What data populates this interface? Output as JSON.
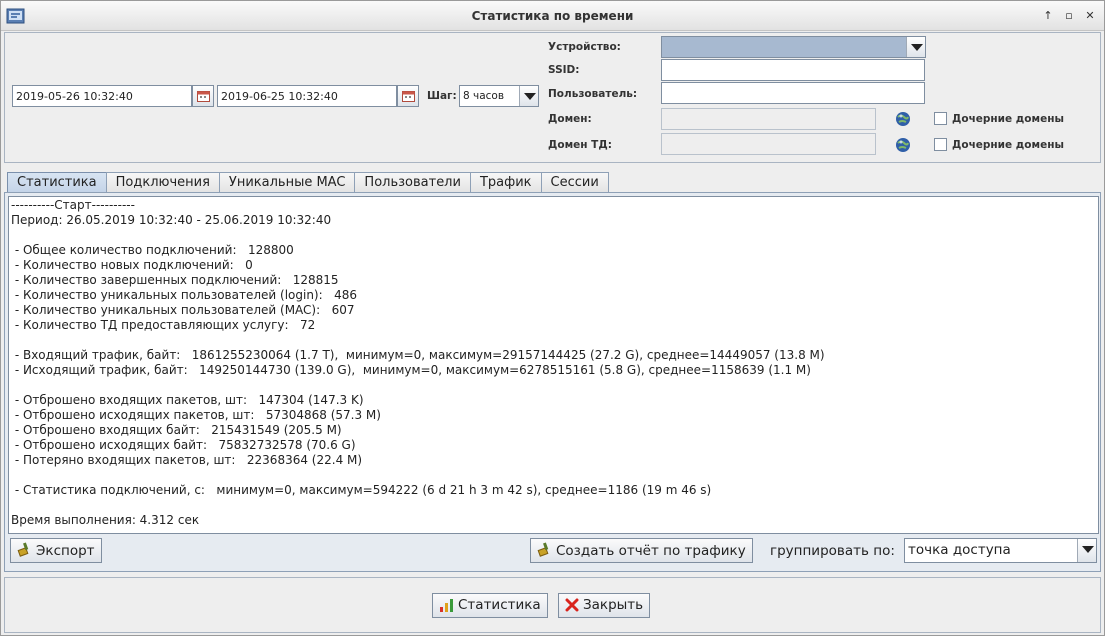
{
  "window": {
    "title": "Статистика по времени"
  },
  "filters": {
    "date_from": "2019-05-26 10:32:40",
    "date_to": "2019-06-25 10:32:40",
    "step_label": "Шаг:",
    "step_value": "8 часов",
    "device_label": "Устройство:",
    "device_value": "",
    "ssid_label": "SSID:",
    "ssid_value": "",
    "user_label": "Пользователь:",
    "user_value": "",
    "domain_label": "Домен:",
    "domain_value": "",
    "domain_child_label": "Дочерние домены",
    "td_domain_label": "Домен ТД:",
    "td_domain_value": "",
    "td_domain_child_label": "Дочерние домены"
  },
  "tabs": [
    {
      "label": "Статистика",
      "active": true
    },
    {
      "label": "Подключения",
      "active": false
    },
    {
      "label": "Уникальные MAC",
      "active": false
    },
    {
      "label": "Пользователи",
      "active": false
    },
    {
      "label": "Трафик",
      "active": false
    },
    {
      "label": "Сессии",
      "active": false
    }
  ],
  "report": {
    "lines": [
      "----------Старт----------",
      "Период: 26.05.2019 10:32:40 - 25.06.2019 10:32:40",
      "",
      " - Общее количество подключений:   128800",
      " - Количество новых подключений:   0",
      " - Количество завершенных подключений:   128815",
      " - Количество уникальных пользователей (login):   486",
      " - Количество уникальных пользователей (MAC):   607",
      " - Количество ТД предоставляющих услугу:   72",
      "",
      " - Входящий трафик, байт:   1861255230064 (1.7 T),  минимум=0, максимум=29157144425 (27.2 G), среднее=14449057 (13.8 M)",
      " - Исходящий трафик, байт:   149250144730 (139.0 G),  минимум=0, максимум=6278515161 (5.8 G), среднее=1158639 (1.1 M)",
      "",
      " - Отброшено входящих пакетов, шт:   147304 (147.3 K)",
      " - Отброшено исходящих пакетов, шт:   57304868 (57.3 M)",
      " - Отброшено входящих байт:   215431549 (205.5 M)",
      " - Отброшено исходящих байт:   75832732578 (70.6 G)",
      " - Потеряно входящих пакетов, шт:   22368364 (22.4 M)",
      "",
      " - Статистика подключений, с:   минимум=0, максимум=594222 (6 d 21 h 3 m 42 s), среднее=1186 (19 m 46 s)",
      "",
      "Время выполнения: 4.312 сек"
    ]
  },
  "actions": {
    "export_label": "Экспорт",
    "traffic_report_label": "Создать отчёт по трафику",
    "group_by_label": "группировать по:",
    "group_by_value": "точка доступа"
  },
  "footer": {
    "statistics_label": "Статистика",
    "close_label": "Закрыть"
  },
  "colors": {
    "accent": "#7b90ac",
    "device_combo_fill": "#a7b9d0"
  },
  "icons": [
    "app-icon",
    "calendar-icon",
    "globe-icon",
    "brush-icon",
    "bar-chart-icon",
    "close-x-icon"
  ]
}
